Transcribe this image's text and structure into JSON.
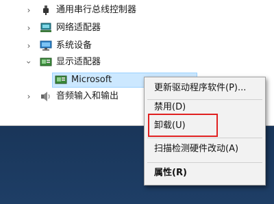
{
  "tree": {
    "items": [
      {
        "label": "通用串行总线控制器",
        "expanded": false,
        "icon": "usb-plug-icon"
      },
      {
        "label": "网络适配器",
        "expanded": false,
        "icon": "network-adapter-icon"
      },
      {
        "label": "系统设备",
        "expanded": false,
        "icon": "monitor-icon"
      },
      {
        "label": "显示适配器",
        "expanded": true,
        "icon": "display-adapter-icon"
      },
      {
        "label": "音频输入和输出",
        "expanded": false,
        "icon": "speaker-icon"
      }
    ],
    "selected_child": {
      "label": "Microsoft",
      "icon": "display-adapter-icon"
    }
  },
  "context_menu": {
    "items": [
      {
        "label": "更新驱动程序软件(P)...",
        "bold": false
      },
      {
        "label": "禁用(D)",
        "bold": false
      },
      {
        "label": "卸载(U)",
        "bold": false,
        "highlighted": true
      },
      {
        "label": "扫描检测硬件改动(A)",
        "bold": false
      },
      {
        "label": "属性(R)",
        "bold": true
      }
    ]
  },
  "colors": {
    "highlight_border": "#e02020",
    "selection_bg": "#cce8ff",
    "desktop_bg": "#173254"
  }
}
